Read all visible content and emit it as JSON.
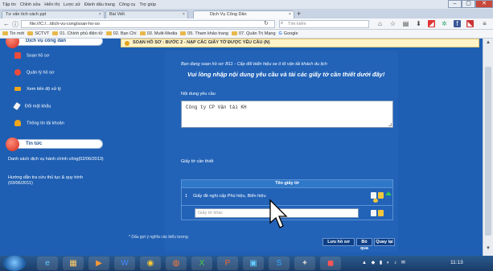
{
  "window": {
    "menu": [
      "Tập tin",
      "Chỉnh sửa",
      "Hiển thị",
      "Lược sử",
      "Đánh dấu trang",
      "Công cụ",
      "Trợ giúp"
    ],
    "controls": [
      "–",
      "▢",
      "✕"
    ]
  },
  "tabs": [
    {
      "label": "Tư vấn tích cách ppt",
      "active": false
    },
    {
      "label": "Bài Viết",
      "active": false
    },
    {
      "label": "Dịch Vụ Công Dân",
      "active": true
    }
  ],
  "address": {
    "url": "file:///C:/.../dich-vu-cong/soan-ho-so",
    "search_placeholder": "Tìm kiếm"
  },
  "bookmarks": [
    "Tin mới",
    "SCTVT",
    "01. Chính phủ điện tử",
    "02. Bạn Chí",
    "03. Multi-Media",
    "05. Tham khảo trang",
    "07. Quản Trị Mạng",
    "Google"
  ],
  "sidebar": {
    "section1_title": "Dịch vụ công dân",
    "items": [
      {
        "label": "Soạn hồ sơ",
        "color": "#e94b3c"
      },
      {
        "label": "Quản lý hồ sơ",
        "color": "#e94b3c"
      },
      {
        "label": "Xem tiến độ xử lý",
        "color": "#f2a51a"
      },
      {
        "label": "Đổi mật khẩu",
        "color": "#f2f2f2"
      },
      {
        "label": "Thông tin tài khoản",
        "color": "#f2a51a"
      }
    ],
    "section2_title": "Tin tức",
    "news": [
      "Danh sách dịch vụ hành chính công(02/06/2013)",
      "Hướng dẫn tra cứu thủ tục & quy trình (03/06/2011)"
    ]
  },
  "main": {
    "breadcrumb": "SOẠN HỒ SƠ : BƯỚC 2 - NẠP CÁC GIẤY TỜ ĐƯỢC YÊU CẦU (N)",
    "current_info": "Bạn đang soạn hồ sơ: B11 - Cấp đổi biển hiệu xe ô tô vận tải khách du lịch",
    "instruction": "Vui lòng nhập nội dung yêu cầu và tài các giấy tờ cần thiết dưới đây!",
    "content_label": "Nội dung yêu cầu",
    "content_value": "Công ty CP Vận tải KH",
    "docs_label": "Giấy tờ cần thiết",
    "table_header": "Tên giấy tờ",
    "rows": [
      {
        "num": "1",
        "name": "Giấy đề nghị cấp Phù hiệu, Biển hiệu"
      }
    ],
    "other_placeholder": "Giấy tờ khác",
    "buttons": {
      "save": "Lưu hồ sơ",
      "skip": "Bỏ qua",
      "back": "Quay lại"
    },
    "footnote": "* Dấu gợi ý nghĩa các biểu tượng"
  },
  "taskbar": {
    "apps": [
      "ie-icon",
      "explorer-icon",
      "media-icon",
      "word-icon",
      "chrome-icon",
      "firefox-icon",
      "excel-icon",
      "powerpoint-icon",
      "photo-icon",
      "skype-icon",
      "tool-icon",
      "video-icon"
    ],
    "clock": "11:13"
  }
}
